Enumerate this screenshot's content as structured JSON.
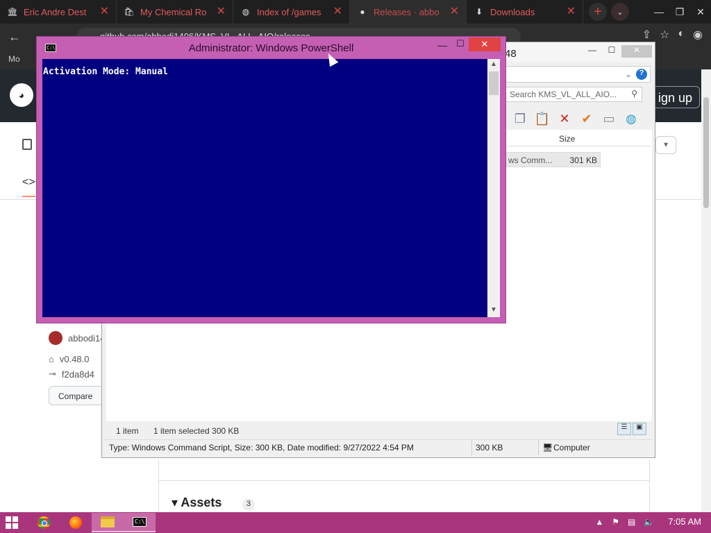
{
  "browser": {
    "tabs": [
      {
        "title": "Eric Andre Dest",
        "icon": "bank-icon"
      },
      {
        "title": "My Chemical Ro",
        "icon": "shopping-bag-icon"
      },
      {
        "title": "Index of /games",
        "icon": "globe-icon"
      },
      {
        "title": "Releases · abbo",
        "icon": "github-icon"
      },
      {
        "title": "Downloads",
        "icon": "download-icon"
      }
    ],
    "url": "github.com/abbodi1406/KMS_VL_ALL_AIO/releases",
    "bookmark_label": "Mo"
  },
  "github": {
    "signup_label": "ign up",
    "author": "abbodi14",
    "tag": "v0.48.0",
    "commit": "f2da8d4",
    "compare_label": "Compare",
    "assets_label": "Assets",
    "assets_count": "3"
  },
  "explorer": {
    "title_fragment": "48",
    "search_placeholder": "Search KMS_VL_ALL_AIO...",
    "column_size": "Size",
    "row": {
      "name": "ws Comm...",
      "size": "301 KB"
    },
    "status_items": "1 item",
    "status_selected": "1 item selected  300 KB",
    "details": "Type: Windows Command Script, Size: 300 KB, Date modified: 9/27/2022 4:54 PM",
    "details_size": "300 KB",
    "details_location": "Computer"
  },
  "powershell": {
    "title": "Administrator: Windows PowerShell",
    "output": "Activation Mode: Manual",
    "accent": "#c55fb3",
    "console_bg": "#000080"
  },
  "taskbar": {
    "apps": [
      "chrome-icon",
      "firefox-icon",
      "file-explorer-icon",
      "powershell-icon"
    ],
    "clock": "7:05 AM",
    "color": "#a9367d"
  }
}
